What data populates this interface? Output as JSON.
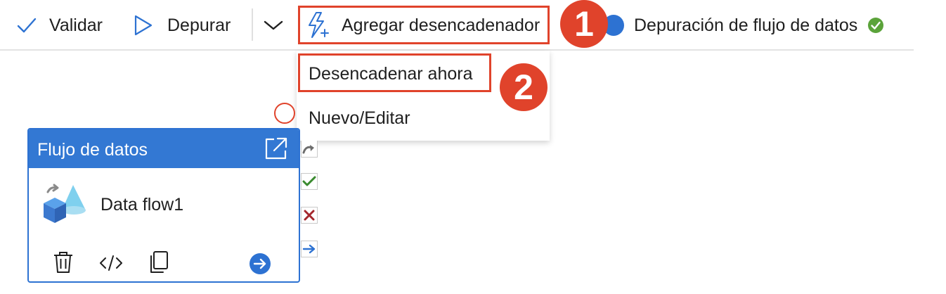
{
  "toolbar": {
    "validate_label": "Validar",
    "debug_label": "Depurar",
    "add_trigger_label": "Agregar desencadenador",
    "dataflow_debug_label": "Depuración de flujo de datos"
  },
  "trigger_menu": {
    "items": [
      {
        "label": "Desencadenar ahora"
      },
      {
        "label": "Nuevo/Editar"
      }
    ]
  },
  "callouts": {
    "one": "1",
    "two": "2"
  },
  "activity_card": {
    "header_title": "Flujo de datos",
    "name": "Data flow1"
  },
  "colors": {
    "accent": "#3378d3",
    "highlight": "#e0432b",
    "success": "#5ba33a",
    "error": "#a4262c"
  },
  "icons": [
    "check-icon",
    "play-outline-icon",
    "chevron-down-icon",
    "lightning-add-icon",
    "toggle-icon",
    "success-icon",
    "open-external-icon",
    "dataflow-icon",
    "delete-icon",
    "code-icon",
    "copy-icon",
    "arrow-circle-right-icon",
    "circle-connector-icon",
    "redo-arrow-icon",
    "success-check-icon",
    "error-x-icon",
    "arrow-right-icon"
  ]
}
